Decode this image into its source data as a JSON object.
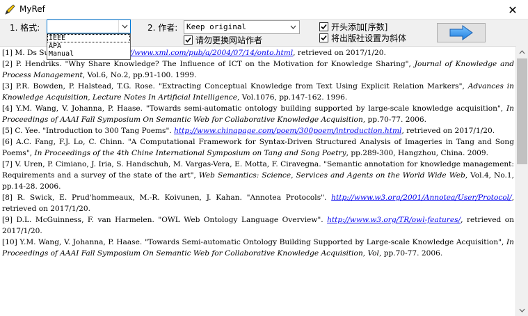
{
  "window": {
    "title": "MyRef",
    "close_label": "✕"
  },
  "toolbar": {
    "format_label": "1. 格式:",
    "format_value": "",
    "format_options": [
      "IEEE",
      "APA",
      "Manual"
    ],
    "author_label": "2. 作者:",
    "author_value": "Keep original",
    "replace_author_checkbox": {
      "label": "请勿更换网站作者",
      "checked": true
    },
    "prefix_checkbox": {
      "label": "开头添加[序数]",
      "checked": true
    },
    "italic_publisher_checkbox": {
      "label": "将出版社设置为斜体",
      "checked": true
    },
    "go_button_icon": "right-arrow-icon"
  },
  "references": [
    {
      "prefix": "[1]    M. D",
      "parts": [
        {
          "t": "s Survey, Revisited\". "
        },
        {
          "link": "http://www.xml.com/pub/a/2004/07/14/onto.html"
        },
        {
          "t": ", retrieved on 2017/1/20."
        }
      ]
    },
    {
      "prefix": "[2]    P. Hendriks. ",
      "parts": [
        {
          "t": "\"Why Share Knowledge? The Influence of ICT on the Motivation for Knowledge Sharing\", "
        },
        {
          "i": "Journal of Knowledge and Process Management"
        },
        {
          "t": ", Vol.6, No.2, pp.91-100. 1999."
        }
      ]
    },
    {
      "prefix": "[3]    P.R. Bowden, P. Halstead, T.G. Rose. ",
      "parts": [
        {
          "t": "\"Extracting Conceptual Knowledge from Text Using Explicit Relation Markers\", "
        },
        {
          "i": "Advances in Knowledge Acquisition, Lecture Notes In Artificial Intelligence"
        },
        {
          "t": ", Vol.1076, pp.147-162. 1996."
        }
      ]
    },
    {
      "prefix": "[4]    Y.M. Wang, V. Johanna, P. Haase. ",
      "parts": [
        {
          "t": "\"Towards semi-automatic ontology building supported by large-scale knowledge acquisition\", "
        },
        {
          "i": "In Proceedings of AAAI Fall Symposium On Semantic Web for Collaborative Knowledge Acquisition"
        },
        {
          "t": ", pp.70-77. 2006."
        }
      ]
    },
    {
      "prefix": "[5]    C. Yee. ",
      "parts": [
        {
          "t": "\"Introduction to 300 Tang Poems\". "
        },
        {
          "link": "http://www.chinapage.com/poem/300poem/introduction.html"
        },
        {
          "t": ", retrieved on 2017/1/20."
        }
      ]
    },
    {
      "prefix": "[6]    A.C. Fang, F.J. Lo, C. Chinn. ",
      "parts": [
        {
          "t": "\"A Computational Framework for Syntax-Driven Structured Analysis of Imageries in Tang and Song Poems\", "
        },
        {
          "i": "In Proceedings of the 4th Chine International Symposium on Tang and Song Poetry"
        },
        {
          "t": ", pp.289-300, Hangzhou, China. 2009."
        }
      ]
    },
    {
      "prefix": "[7]    V. Uren, P. Cimiano, J. Iria, S. Handschuh, M. Vargas-Vera, E. Motta, F. Ciravegna. ",
      "parts": [
        {
          "t": "\"Semantic annotation for knowledge management: Requirements and a survey of the state of the art\", "
        },
        {
          "i": "Web Semantics: Science, Services and Agents on the World Wide Web"
        },
        {
          "t": ", Vol.4, No.1, pp.14-28. 2006."
        }
      ]
    },
    {
      "prefix": "[8]    R. Swick, E. Prud'hommeaux, M.-R. Koivunen, J. Kahan. ",
      "parts": [
        {
          "t": "\"Annotea Protocols\". "
        },
        {
          "link": "http://www.w3.org/2001/Annotea/User/Protocol/"
        },
        {
          "t": ", retrieved on 2017/1/20."
        }
      ]
    },
    {
      "prefix": "[9]    D.L. McGuinness, F. van Harmelen. ",
      "parts": [
        {
          "t": "\"OWL Web Ontology Language Overview\". "
        },
        {
          "link": "http://www.w3.org/TR/owl-features/"
        },
        {
          "t": ", retrieved on 2017/1/20."
        }
      ]
    },
    {
      "prefix": "[10]    Y.M. Wang, V. Johanna, P. Haase. ",
      "parts": [
        {
          "t": "\"Towards Semi-automatic Ontology Building Supported by Large-scale Knowledge Acquisition\", "
        },
        {
          "i": "In Proceedings of AAAI Fall Symposium On Semantic Web for Collaborative Knowledge Acquisition, Vol"
        },
        {
          "t": ", pp.70-77. 2006."
        }
      ]
    }
  ],
  "colors": {
    "link": "#0000ee",
    "accent": "#0078d7",
    "arrow": "#1e90ff"
  }
}
